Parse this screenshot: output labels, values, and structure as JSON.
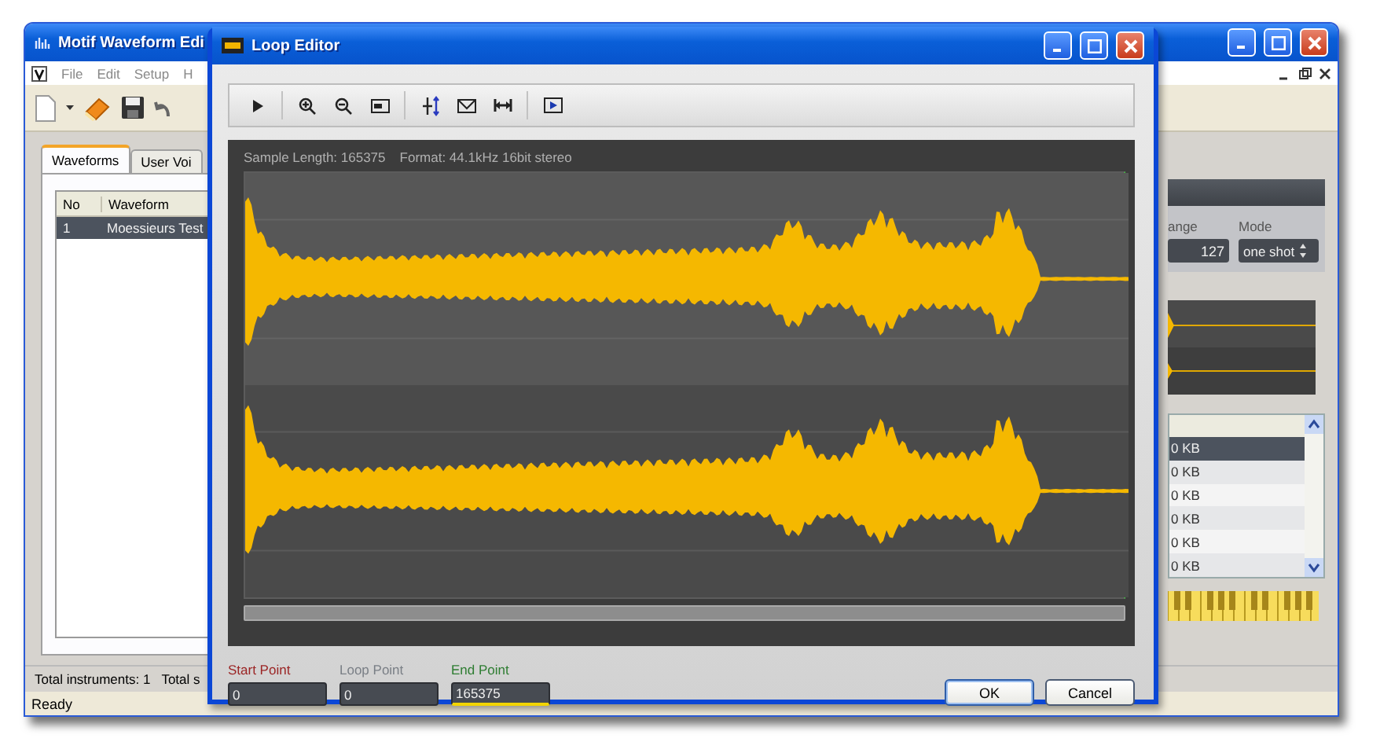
{
  "main_window": {
    "title": "Motif Waveform Edi",
    "menu": [
      "File",
      "Edit",
      "Setup",
      "H"
    ],
    "tabs": [
      {
        "label": "Waveforms",
        "selected": true
      },
      {
        "label": "User Voi",
        "selected": false
      }
    ],
    "waveform_list": {
      "columns": [
        "No",
        "Waveform"
      ],
      "rows": [
        {
          "no": "1",
          "name": "Moessieurs Test",
          "selected": true
        }
      ]
    },
    "right_panel": {
      "labels": [
        "ange",
        "Mode"
      ],
      "range_value": "127",
      "mode_value": "one shot",
      "sizes": [
        {
          "text": "0 KB",
          "selected": true
        },
        {
          "text": "0 KB",
          "selected": false
        },
        {
          "text": "0 KB",
          "selected": false
        },
        {
          "text": "0 KB",
          "selected": false
        },
        {
          "text": "0 KB",
          "selected": false
        },
        {
          "text": "0 KB",
          "selected": false
        }
      ]
    },
    "status": {
      "totals": [
        "Total instruments: 1",
        "Total s"
      ],
      "message": "Ready"
    }
  },
  "dialog": {
    "title": "Loop Editor",
    "info": [
      "Sample Length: 165375",
      "Format: 44.1kHz 16bit stereo"
    ],
    "points": [
      {
        "label": "Start Point",
        "value": "0",
        "kind": "start",
        "selected": false
      },
      {
        "label": "Loop Point",
        "value": "0",
        "kind": "loop",
        "selected": false
      },
      {
        "label": "End Point",
        "value": "165375",
        "kind": "end",
        "selected": true
      }
    ],
    "buttons": [
      {
        "label": "OK",
        "kind": "default"
      },
      {
        "label": "Cancel",
        "kind": "normal"
      }
    ]
  }
}
